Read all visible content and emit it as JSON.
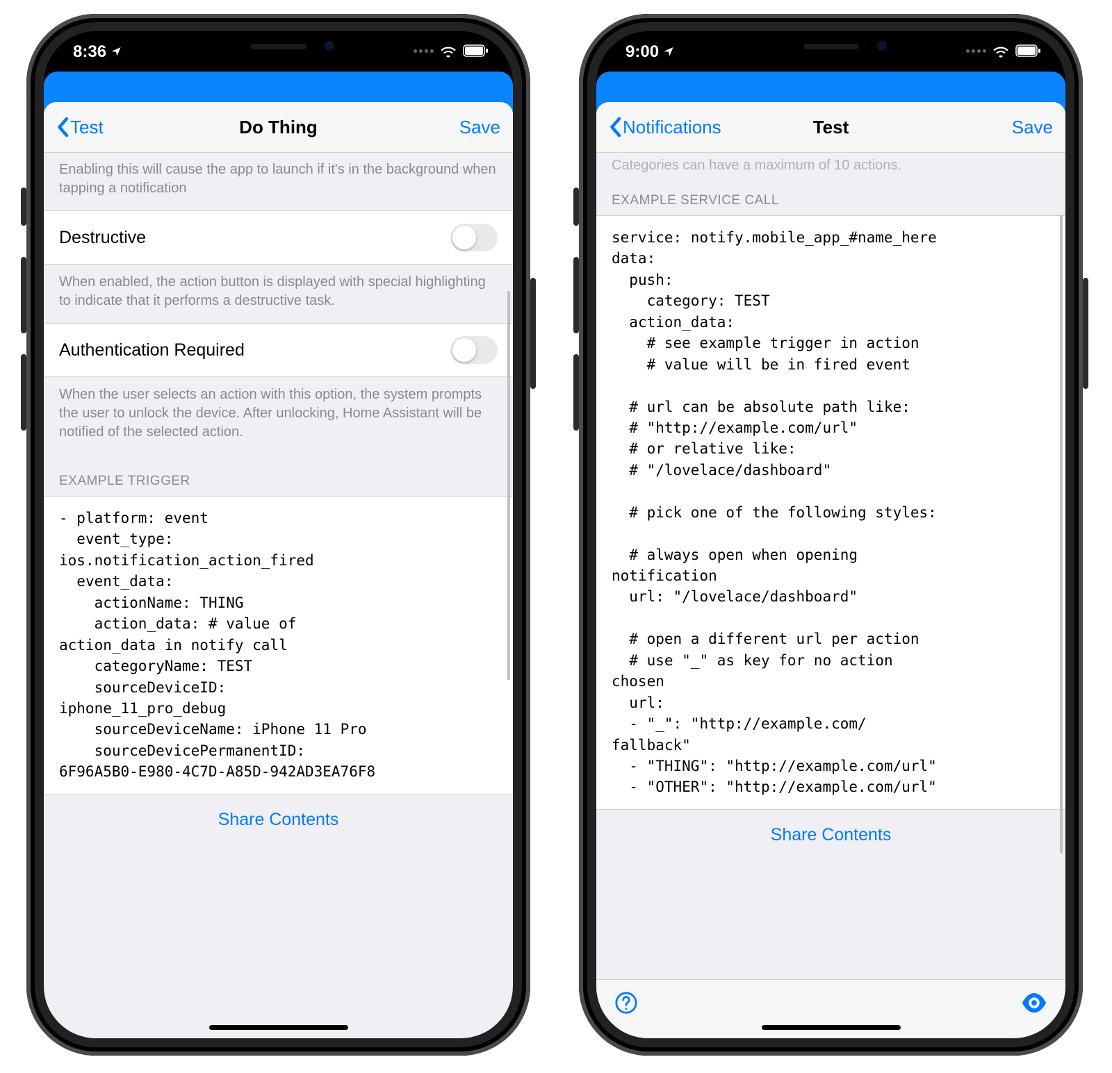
{
  "left": {
    "status_time": "8:36",
    "nav_back": "Test",
    "nav_title": "Do Thing",
    "nav_save": "Save",
    "launch_desc": "Enabling this will cause the app to launch if it's in the background when tapping a notification",
    "destructive_label": "Destructive",
    "destructive_desc": "When enabled, the action button is displayed with special highlighting to indicate that it performs a destructive task.",
    "auth_label": "Authentication Required",
    "auth_desc": "When the user selects an action with this option, the system prompts the user to unlock the device. After unlocking, Home Assistant will be notified of the selected action.",
    "example_trigger_header": "EXAMPLE TRIGGER",
    "example_trigger_code": "- platform: event\n  event_type:\nios.notification_action_fired\n  event_data:\n    actionName: THING\n    action_data: # value of\naction_data in notify call\n    categoryName: TEST\n    sourceDeviceID:\niphone_11_pro_debug\n    sourceDeviceName: iPhone 11 Pro\n    sourceDevicePermanentID:\n6F96A5B0-E980-4C7D-A85D-942AD3EA76F8",
    "share_label": "Share Contents"
  },
  "right": {
    "status_time": "9:00",
    "nav_back": "Notifications",
    "nav_title": "Test",
    "nav_save": "Save",
    "cutoff_text": "Categories can have a maximum of 10 actions.",
    "example_service_header": "EXAMPLE SERVICE CALL",
    "example_service_code": "service: notify.mobile_app_#name_here\ndata:\n  push:\n    category: TEST\n  action_data:\n    # see example trigger in action\n    # value will be in fired event\n\n  # url can be absolute path like:\n  # \"http://example.com/url\"\n  # or relative like:\n  # \"/lovelace/dashboard\"\n\n  # pick one of the following styles:\n\n  # always open when opening\nnotification\n  url: \"/lovelace/dashboard\"\n\n  # open a different url per action\n  # use \"_\" as key for no action\nchosen\n  url:\n  - \"_\": \"http://example.com/\nfallback\"\n  - \"THING\": \"http://example.com/url\"\n  - \"OTHER\": \"http://example.com/url\"",
    "share_label": "Share Contents"
  }
}
